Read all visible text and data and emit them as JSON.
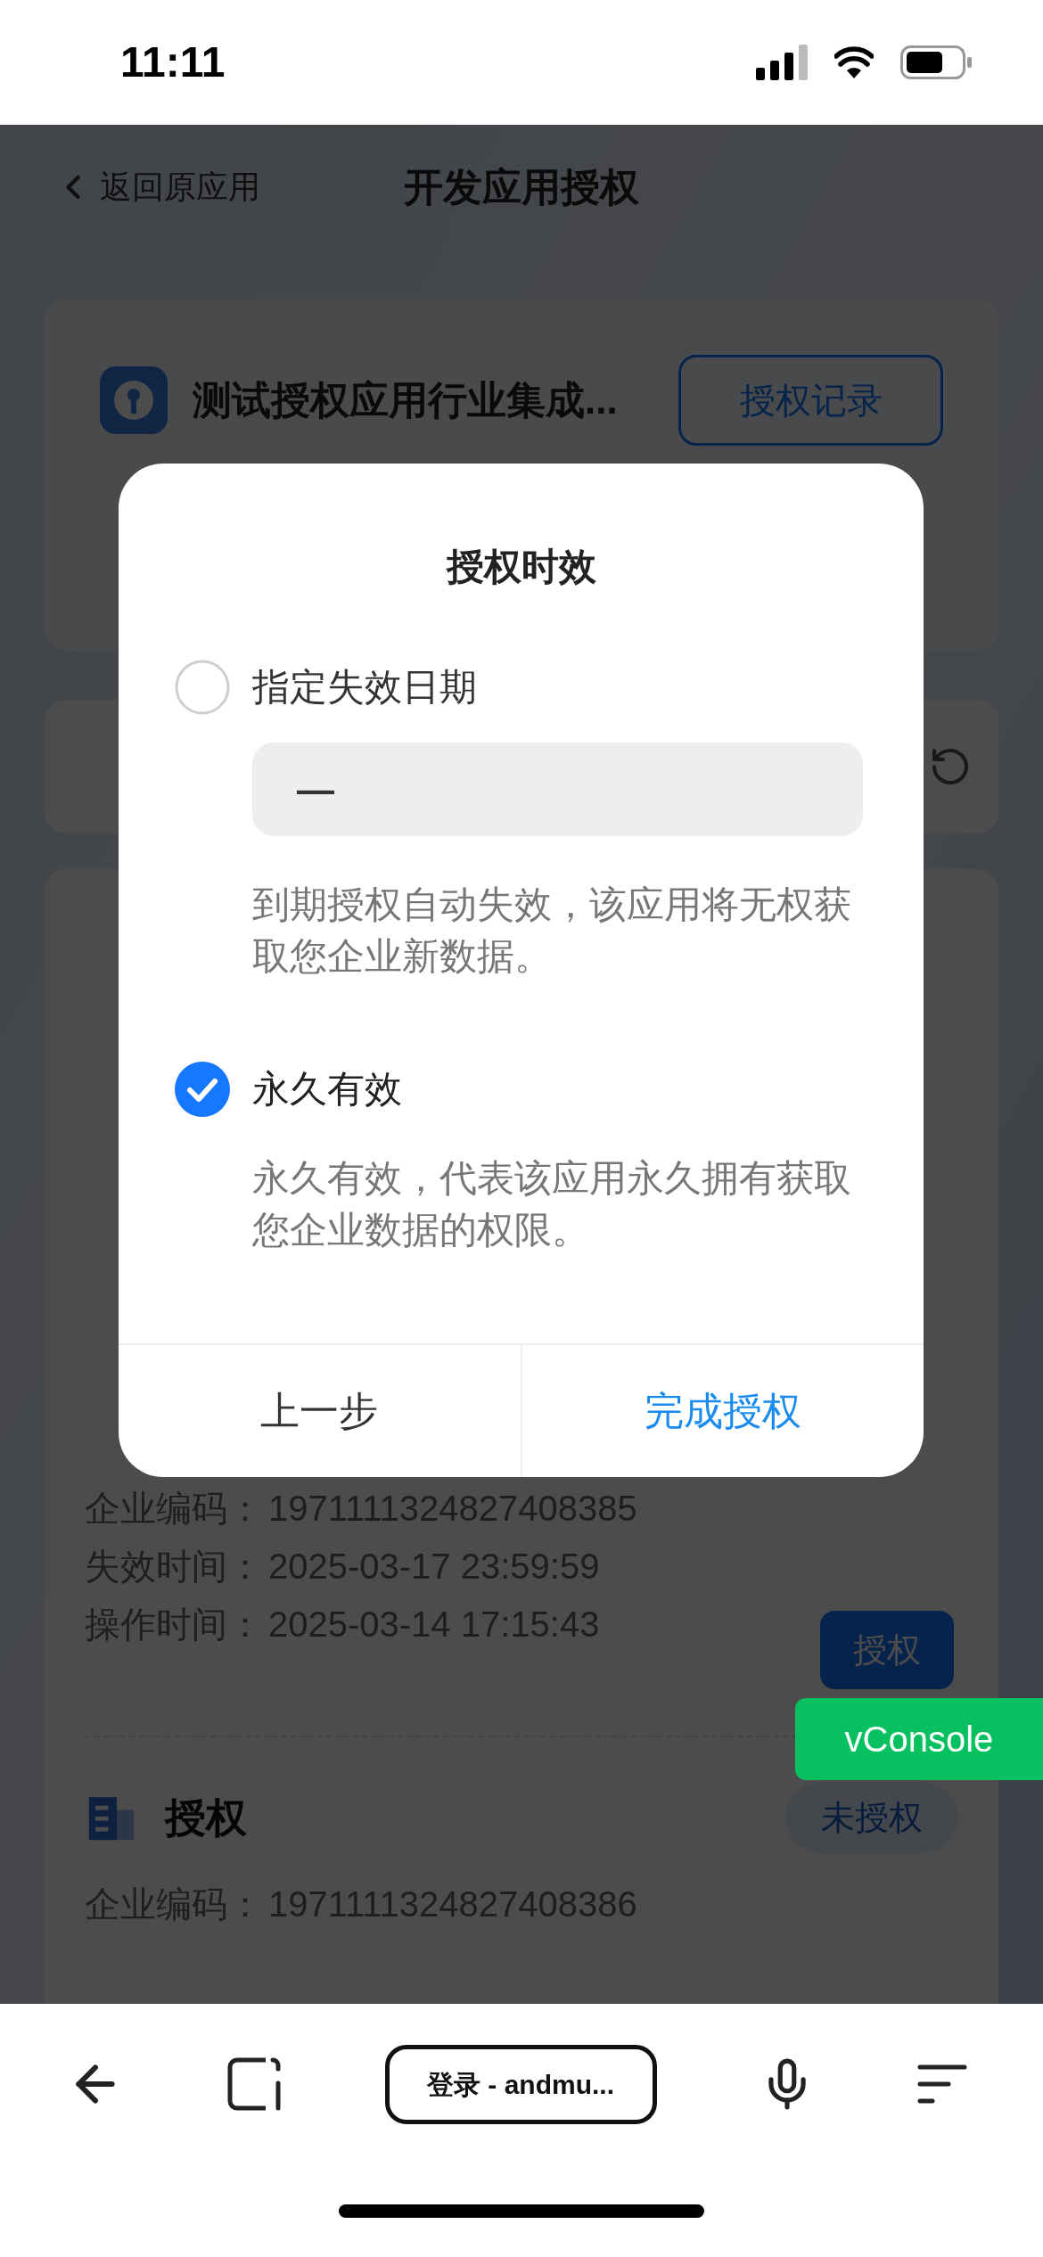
{
  "status_bar": {
    "time": "11:11"
  },
  "header": {
    "back_label": "返回原应用",
    "title": "开发应用授权"
  },
  "app_card": {
    "app_name": "测试授权应用行业集成...",
    "records_button": "授权记录"
  },
  "records": [
    {
      "fields": [
        {
          "label": "企业编码：",
          "value": "1971111324827408385"
        },
        {
          "label": "失效时间：",
          "value": "2025-03-17 23:59:59"
        },
        {
          "label": "操作时间：",
          "value": "2025-03-14 17:15:43"
        }
      ],
      "action": "授权"
    },
    {
      "title": "授权",
      "status": "未授权",
      "fields": [
        {
          "label": "企业编码：",
          "value": "1971111324827408386"
        }
      ]
    }
  ],
  "dialog": {
    "title": "授权时效",
    "options": [
      {
        "label": "指定失效日期",
        "selected": false,
        "date_value": "—",
        "description": "到期授权自动失效，该应用将无权获取您企业新数据。"
      },
      {
        "label": "永久有效",
        "selected": true,
        "description": "永久有效，代表该应用永久拥有获取您企业数据的权限。"
      }
    ],
    "buttons": [
      {
        "label": "上一步",
        "kind": "secondary"
      },
      {
        "label": "完成授权",
        "kind": "primary"
      }
    ]
  },
  "vconsole_button": "vConsole",
  "browser_bar": {
    "url": "登录 - andmu..."
  }
}
